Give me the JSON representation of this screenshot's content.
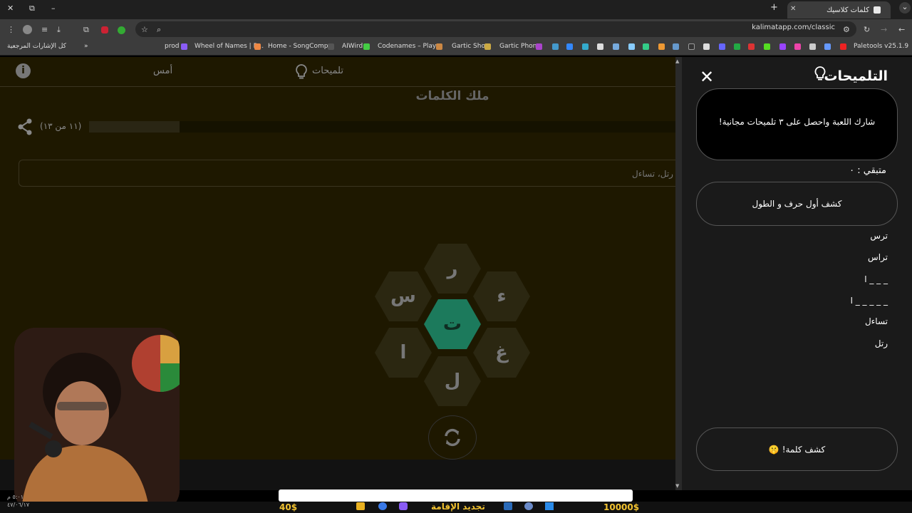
{
  "browser": {
    "tab_title": "كلمات كلاسيك",
    "url": "kalimatapp.com/classic",
    "bookmarks": [
      "كل الإشارات المرجعية",
      "prod",
      "Wheel of Names | R...",
      "Home - SongComp...",
      "AIWird",
      "Codenames – Play...",
      "Gartic Show",
      "Gartic Phone",
      "Paletools v25.1.9"
    ]
  },
  "game": {
    "nav_yesterday": "أمس",
    "nav_hints": "تلميحات",
    "board_title": "ملك الكلمات",
    "progress_text": "(١١ من ١٣)",
    "progress_fraction": 0.846,
    "found_words_text": "اس، رتل، تساءل",
    "letters": {
      "top": "ر",
      "top_right": "ء",
      "bottom_right": "غ",
      "bottom": "ل",
      "bottom_left": "ا",
      "top_left": "س",
      "center": "ت"
    }
  },
  "hints": {
    "title": "التلميحات",
    "share_text": "شارك اللعبة واحصل على ٣ تلميحات مجانية!",
    "remaining_label": "متبقي : ٠",
    "reveal_first_button": "كشف أول حرف و الطول",
    "lines": [
      "ترس",
      "تراس",
      "ا _ _ _",
      "ا _ _ _ _ _",
      "تساءل",
      "رتل"
    ],
    "reveal_word_button": "كشف كلمة!",
    "reveal_word_emoji": "🤫"
  },
  "stream_overlay": {
    "money_left": "40$",
    "money_right": "10000$",
    "ticker": "تجديد الإقامة",
    "clock_time": "٥:٠١ م",
    "clock_date": "٤٧/٠٦/١٧"
  },
  "colors": {
    "accent": "#1c7a5c",
    "page_bg": "#1e1800",
    "panel_bg": "#1a1a1a",
    "gold": "#f2c230"
  }
}
